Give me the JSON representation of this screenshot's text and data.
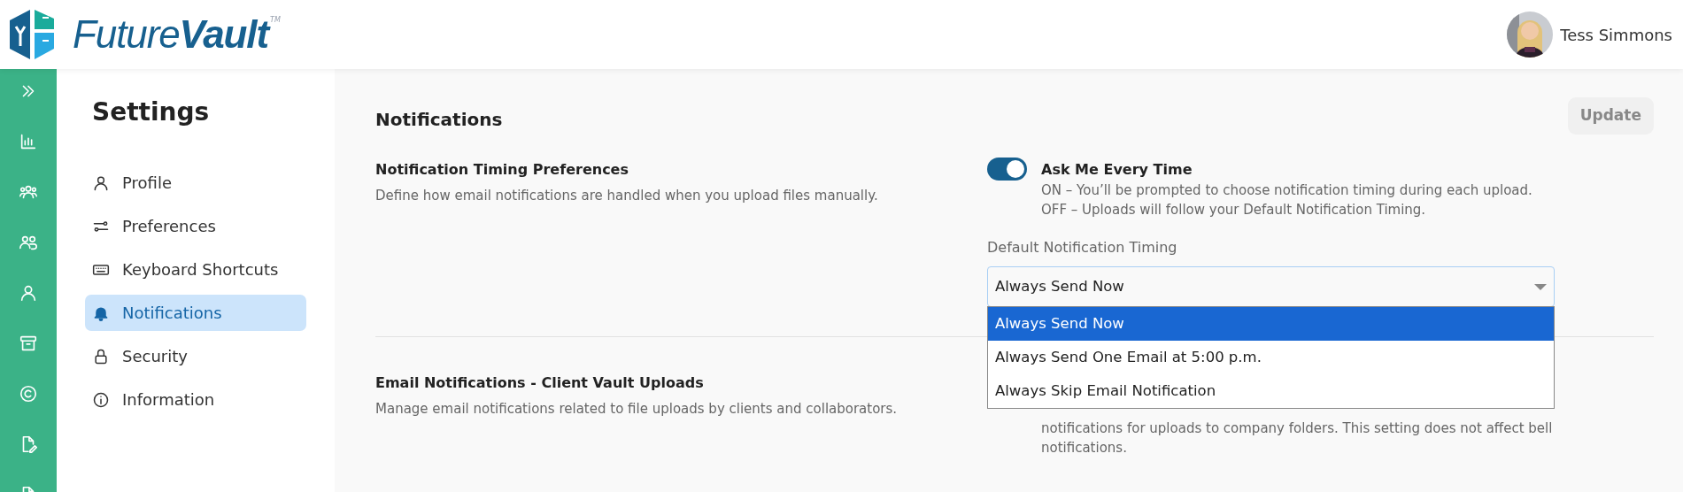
{
  "header": {
    "logo_text": "Future",
    "logo_text_bold": "Vault",
    "trademark": "TM",
    "user_name": "Tess Simmons"
  },
  "settings_nav": {
    "title": "Settings",
    "items": [
      {
        "label": "Profile",
        "selected": false
      },
      {
        "label": "Preferences",
        "selected": false
      },
      {
        "label": "Keyboard Shortcuts",
        "selected": false
      },
      {
        "label": "Notifications",
        "selected": true
      },
      {
        "label": "Security",
        "selected": false
      },
      {
        "label": "Information",
        "selected": false
      }
    ]
  },
  "main": {
    "title": "Notifications",
    "update_button": "Update",
    "sections": [
      {
        "title": "Notification Timing Preferences",
        "description": "Define how email notifications are handled when you upload files manually.",
        "toggle": {
          "on": true,
          "label": "Ask Me Every Time",
          "lines": [
            "ON – You’ll be prompted to choose notification timing during each upload.",
            "OFF – Uploads will follow your Default Notification Timing."
          ]
        },
        "select": {
          "label": "Default Notification Timing",
          "value": "Always Send Now",
          "expanded": true,
          "options": [
            {
              "label": "Always Send Now",
              "selected": true
            },
            {
              "label": "Always Send One Email at 5:00 p.m.",
              "selected": false
            },
            {
              "label": "Always Skip Email Notification",
              "selected": false
            }
          ]
        }
      },
      {
        "title": "Email Notifications - Client Vault Uploads",
        "description": "Manage email notifications related to file uploads by clients and collaborators.",
        "toggle": {
          "lines": [
            "notifications for uploads to company folders. This setting does not affect bell",
            "notifications."
          ]
        }
      }
    ]
  }
}
